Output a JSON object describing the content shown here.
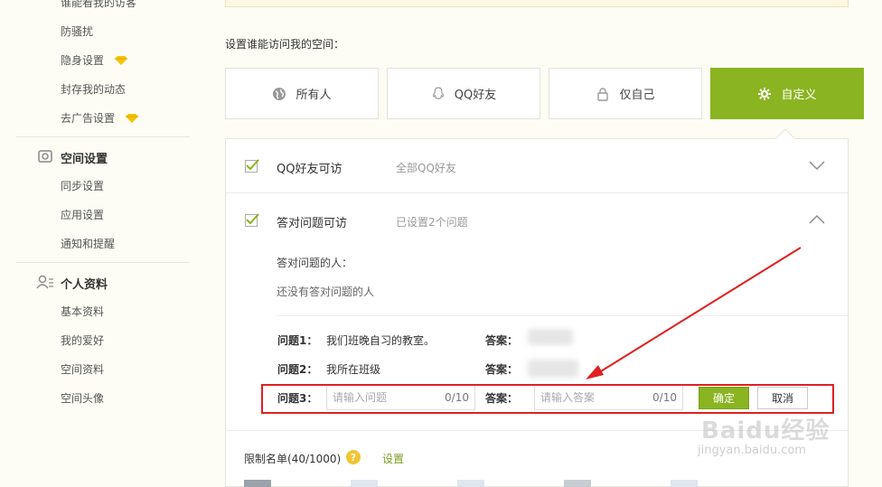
{
  "sidebar": {
    "privacy_items": [
      {
        "label": "谁能看我的访客",
        "gem": false
      },
      {
        "label": "防骚扰",
        "gem": false
      },
      {
        "label": "隐身设置",
        "gem": true
      },
      {
        "label": "封存我的动态",
        "gem": false
      },
      {
        "label": "去广告设置",
        "gem": true
      }
    ],
    "space_settings": {
      "title": "空间设置",
      "items": [
        "同步设置",
        "应用设置",
        "通知和提醒"
      ]
    },
    "profile": {
      "title": "个人资料",
      "items": [
        "基本资料",
        "我的爱好",
        "空间资料",
        "空间头像"
      ]
    }
  },
  "main": {
    "access_label": "设置谁能访问我的空间：",
    "options": [
      {
        "label": "所有人",
        "icon": "globe-icon"
      },
      {
        "label": "QQ好友",
        "icon": "qq-penguin-icon"
      },
      {
        "label": "仅自己",
        "icon": "lock-icon"
      },
      {
        "label": "自定义",
        "icon": "gear-icon"
      }
    ],
    "selected_option": "自定义",
    "qq_friends_row": {
      "title": "QQ好友可访",
      "sub": "全部QQ好友",
      "checked": true
    },
    "answer_row": {
      "title": "答对问题可访",
      "sub": "已设置2个问题",
      "checked": true,
      "answered_label": "答对问题的人：",
      "answered_empty": "还没有答对问题的人"
    },
    "questions": [
      {
        "label": "问题1：",
        "text": "我们班晚自习的教室。",
        "answer_label": "答案："
      },
      {
        "label": "问题2：",
        "text": "我所在班级",
        "answer_label": "答案："
      }
    ],
    "new_question": {
      "label": "问题3：",
      "question_placeholder": "请输入问题",
      "question_count": "0/10",
      "answer_label": "答案：",
      "answer_placeholder": "请输入答案",
      "answer_count": "0/10",
      "confirm": "确定",
      "cancel": "取消"
    },
    "blocklist": {
      "label": "限制名单(40/1000)",
      "help": "?",
      "settings": "设置"
    }
  },
  "watermark": {
    "line1": "Baidu经验",
    "line2": "jingyan.baidu.com"
  },
  "colors": {
    "accent": "#8ab421",
    "highlight": "#e02020",
    "gem": "#f5c400"
  }
}
